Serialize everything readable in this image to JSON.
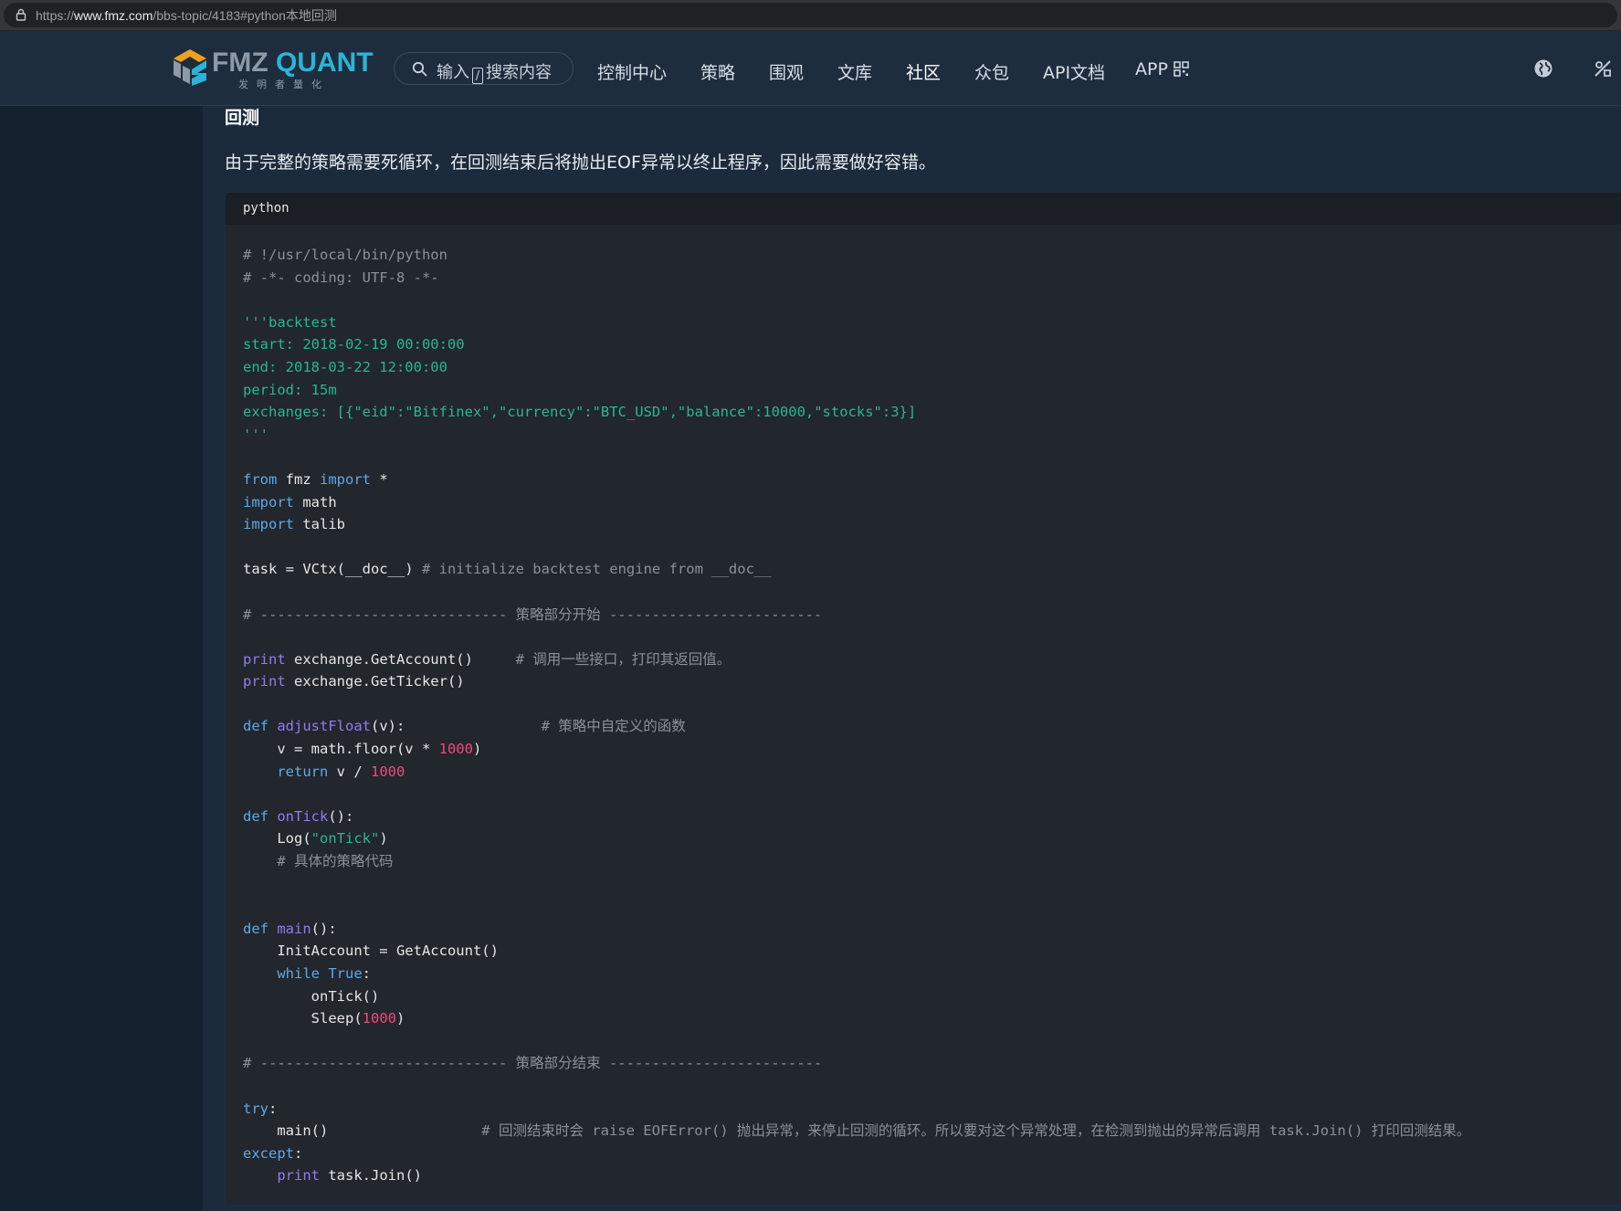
{
  "browser": {
    "url_prefix": "https://",
    "url_host": "www.fmz.com",
    "url_path": "/bbs-topic/4183#python本地回测"
  },
  "header": {
    "logo_fmz": "FMZ",
    "logo_quant": "QUANT",
    "logo_sub": "发明者量化",
    "search_before": "输入",
    "search_key": "/",
    "search_after": "搜索内容",
    "nav": [
      {
        "label": "控制中心"
      },
      {
        "label": "策略"
      },
      {
        "label": "围观"
      },
      {
        "label": "文库"
      },
      {
        "label": "社区"
      },
      {
        "label": "众包"
      },
      {
        "label": "API文档"
      },
      {
        "label": "APP"
      }
    ]
  },
  "article": {
    "heading": "回测",
    "paragraph": "由于完整的策略需要死循环，在回测结束后将抛出EOF异常以终止程序，因此需要做好容错。",
    "code_language": "python",
    "code_lines": [
      [
        {
          "t": "# !/usr/local/bin/python",
          "c": "com"
        }
      ],
      [
        {
          "t": "# -*- coding: UTF-8 -*-",
          "c": "com"
        }
      ],
      [],
      [
        {
          "t": "'''backtest",
          "c": "str"
        }
      ],
      [
        {
          "t": "start: 2018-02-19 00:00:00",
          "c": "str"
        }
      ],
      [
        {
          "t": "end: 2018-03-22 12:00:00",
          "c": "str"
        }
      ],
      [
        {
          "t": "period: 15m",
          "c": "str"
        }
      ],
      [
        {
          "t": "exchanges: [{\"eid\":\"Bitfinex\",\"currency\":\"BTC_USD\",\"balance\":10000,\"stocks\":3}]",
          "c": "str"
        }
      ],
      [
        {
          "t": "'''",
          "c": "str"
        }
      ],
      [],
      [
        {
          "t": "from",
          "c": "kw"
        },
        {
          "t": " fmz ",
          "c": "txt"
        },
        {
          "t": "import",
          "c": "kw"
        },
        {
          "t": " *",
          "c": "txt"
        }
      ],
      [
        {
          "t": "import",
          "c": "kw"
        },
        {
          "t": " math",
          "c": "txt"
        }
      ],
      [
        {
          "t": "import",
          "c": "kw"
        },
        {
          "t": " talib",
          "c": "txt"
        }
      ],
      [],
      [
        {
          "t": "task = VCtx(__doc__) ",
          "c": "txt"
        },
        {
          "t": "# initialize backtest engine from __doc__",
          "c": "com"
        }
      ],
      [],
      [
        {
          "t": "# ----------------------------- 策略部分开始 -------------------------",
          "c": "com"
        }
      ],
      [],
      [
        {
          "t": "print",
          "c": "fn"
        },
        {
          "t": " exchange.GetAccount()     ",
          "c": "txt"
        },
        {
          "t": "# 调用一些接口，打印其返回值。",
          "c": "com"
        }
      ],
      [
        {
          "t": "print",
          "c": "fn"
        },
        {
          "t": " exchange.GetTicker()",
          "c": "txt"
        }
      ],
      [],
      [
        {
          "t": "def",
          "c": "kw"
        },
        {
          "t": " ",
          "c": "txt"
        },
        {
          "t": "adjustFloat",
          "c": "fn"
        },
        {
          "t": "(v):                ",
          "c": "txt"
        },
        {
          "t": "# 策略中自定义的函数",
          "c": "com"
        }
      ],
      [
        {
          "t": "    v = math.floor(v * ",
          "c": "txt"
        },
        {
          "t": "1000",
          "c": "num"
        },
        {
          "t": ")",
          "c": "txt"
        }
      ],
      [
        {
          "t": "    ",
          "c": "txt"
        },
        {
          "t": "return",
          "c": "kw"
        },
        {
          "t": " v / ",
          "c": "txt"
        },
        {
          "t": "1000",
          "c": "num"
        }
      ],
      [],
      [
        {
          "t": "def",
          "c": "kw"
        },
        {
          "t": " ",
          "c": "txt"
        },
        {
          "t": "onTick",
          "c": "fn"
        },
        {
          "t": "():",
          "c": "txt"
        }
      ],
      [
        {
          "t": "    Log(",
          "c": "txt"
        },
        {
          "t": "\"onTick\"",
          "c": "str"
        },
        {
          "t": ")",
          "c": "txt"
        }
      ],
      [
        {
          "t": "    # 具体的策略代码",
          "c": "com"
        }
      ],
      [],
      [],
      [
        {
          "t": "def",
          "c": "kw"
        },
        {
          "t": " ",
          "c": "txt"
        },
        {
          "t": "main",
          "c": "fn"
        },
        {
          "t": "():",
          "c": "txt"
        }
      ],
      [
        {
          "t": "    InitAccount = GetAccount()",
          "c": "txt"
        }
      ],
      [
        {
          "t": "    ",
          "c": "txt"
        },
        {
          "t": "while",
          "c": "kw"
        },
        {
          "t": " ",
          "c": "txt"
        },
        {
          "t": "True",
          "c": "kw"
        },
        {
          "t": ":",
          "c": "txt"
        }
      ],
      [
        {
          "t": "        onTick()",
          "c": "txt"
        }
      ],
      [
        {
          "t": "        Sleep(",
          "c": "txt"
        },
        {
          "t": "1000",
          "c": "num"
        },
        {
          "t": ")",
          "c": "txt"
        }
      ],
      [],
      [
        {
          "t": "# ----------------------------- 策略部分结束 -------------------------",
          "c": "com"
        }
      ],
      [],
      [
        {
          "t": "try",
          "c": "kw"
        },
        {
          "t": ":",
          "c": "txt"
        }
      ],
      [
        {
          "t": "    main()                  ",
          "c": "txt"
        },
        {
          "t": "# 回测结束时会 raise EOFError() 抛出异常，来停止回测的循环。所以要对这个异常处理，在检测到抛出的异常后调用 task.Join() 打印回测结果。",
          "c": "com"
        }
      ],
      [
        {
          "t": "except",
          "c": "kw"
        },
        {
          "t": ":",
          "c": "txt"
        }
      ],
      [
        {
          "t": "    ",
          "c": "txt"
        },
        {
          "t": "print",
          "c": "fn"
        },
        {
          "t": " task.Join()",
          "c": "txt"
        }
      ]
    ]
  }
}
